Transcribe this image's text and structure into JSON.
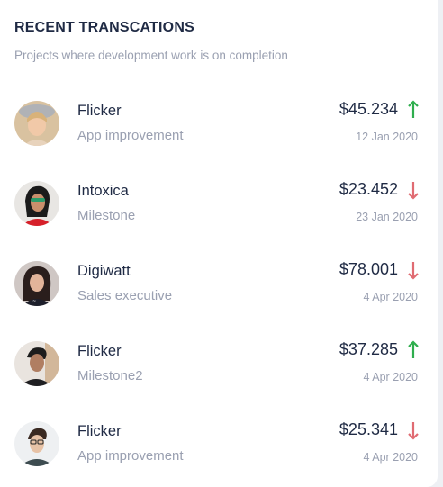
{
  "header": {
    "title": "RECENT TRANSCATIONS",
    "subtitle": "Projects where development work is on completion"
  },
  "colors": {
    "up": "#2fae4e",
    "down": "#e06b72"
  },
  "transactions": [
    {
      "name": "Flicker",
      "role": "App improvement",
      "amount": "$45.234",
      "date": "12 Jan 2020",
      "trend": "up",
      "trend_icon": "arrow-up-icon"
    },
    {
      "name": "Intoxica",
      "role": "Milestone",
      "amount": "$23.452",
      "date": "23 Jan 2020",
      "trend": "down",
      "trend_icon": "arrow-down-icon"
    },
    {
      "name": "Digiwatt",
      "role": "Sales executive",
      "amount": "$78.001",
      "date": "4 Apr 2020",
      "trend": "down",
      "trend_icon": "arrow-down-icon"
    },
    {
      "name": "Flicker",
      "role": "Milestone2",
      "amount": "$37.285",
      "date": "4 Apr 2020",
      "trend": "up",
      "trend_icon": "arrow-up-icon"
    },
    {
      "name": "Flicker",
      "role": "App improvement",
      "amount": "$25.341",
      "date": "4 Apr 2020",
      "trend": "down",
      "trend_icon": "arrow-down-icon"
    }
  ]
}
